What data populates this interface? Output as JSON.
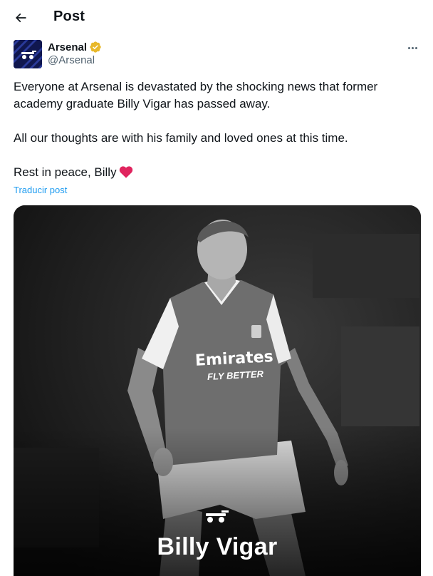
{
  "header": {
    "title": "Post",
    "back_icon": "arrow-left-icon"
  },
  "author": {
    "display_name": "Arsenal",
    "handle": "@Arsenal",
    "verified_color": "#e8b829",
    "more_icon": "ellipsis-icon"
  },
  "tweet": {
    "line1": "Everyone at Arsenal is devastated by the shocking news that former academy graduate Billy Vigar has passed away.",
    "line2": "All our thoughts are with his family and loved ones at this time.",
    "line3": "Rest in peace, Billy",
    "heart_color": "#e0245e",
    "translate_label": "Traducir post"
  },
  "media": {
    "caption": "Billy Vigar",
    "shirt_sponsor": "Emirates",
    "shirt_sponsor_sub": "FLY BETTER"
  }
}
